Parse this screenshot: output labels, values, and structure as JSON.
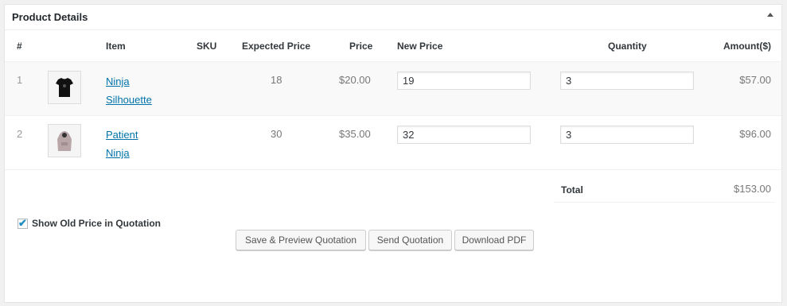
{
  "panel": {
    "title": "Product Details"
  },
  "table": {
    "headers": {
      "index": "#",
      "item": "Item",
      "sku": "SKU",
      "expected_price": "Expected Price",
      "price": "Price",
      "new_price": "New Price",
      "quantity": "Quantity",
      "amount": "Amount($)"
    },
    "rows": [
      {
        "index": "1",
        "item_line1": "Ninja",
        "item_line2": "Silhouette",
        "sku": "",
        "expected_price": "18",
        "price": "$20.00",
        "new_price": "19",
        "quantity": "3",
        "amount": "$57.00",
        "thumb_icon": "tshirt-icon"
      },
      {
        "index": "2",
        "item_line1": "Patient",
        "item_line2": "Ninja",
        "sku": "",
        "expected_price": "30",
        "price": "$35.00",
        "new_price": "32",
        "quantity": "3",
        "amount": "$96.00",
        "thumb_icon": "hoodie-icon"
      }
    ],
    "total_label": "Total",
    "total_value": "$153.00"
  },
  "options": {
    "show_old_price_label": "Show Old Price in Quotation",
    "show_old_price_checked": true
  },
  "buttons": {
    "save_preview": "Save & Preview Quotation",
    "send": "Send Quotation",
    "download_pdf": "Download PDF"
  },
  "colors": {
    "link": "#0073aa",
    "check": "#1e8cbe"
  }
}
